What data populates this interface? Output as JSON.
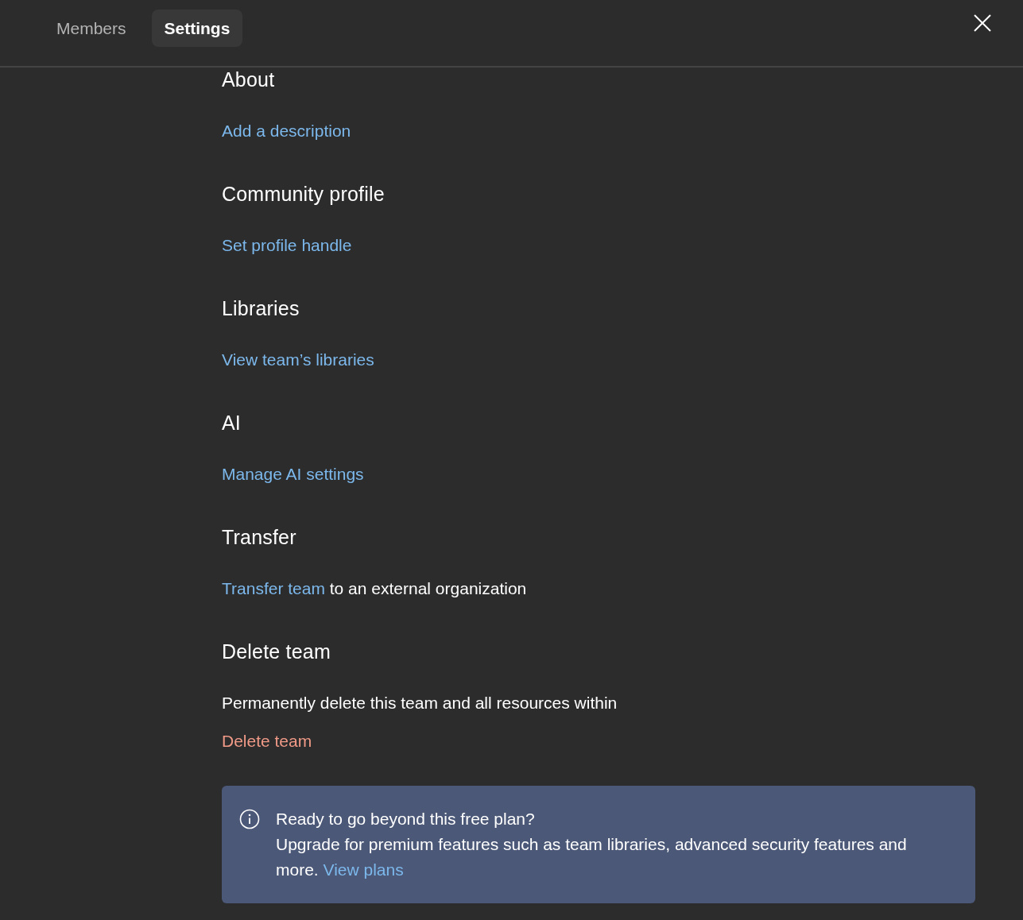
{
  "tabs": [
    {
      "label": "Members",
      "selected": false
    },
    {
      "label": "Settings",
      "selected": true
    }
  ],
  "sections": [
    {
      "title": "About",
      "items": [
        {
          "kind": "link",
          "text": "Add a description"
        }
      ]
    },
    {
      "title": "Community profile",
      "items": [
        {
          "kind": "link",
          "text": "Set profile handle"
        }
      ]
    },
    {
      "title": "Libraries",
      "items": [
        {
          "kind": "link",
          "text": "View team’s libraries"
        }
      ]
    },
    {
      "title": "AI",
      "items": [
        {
          "kind": "link",
          "text": "Manage AI settings"
        }
      ]
    },
    {
      "title": "Transfer",
      "items": [
        {
          "kind": "link_sentence",
          "link": "Transfer team",
          "text": "to an external organization"
        }
      ]
    },
    {
      "title": "Delete team",
      "items": [
        {
          "kind": "text",
          "text": "Permanently delete this team and all resources within"
        },
        {
          "kind": "danger_link",
          "text": "Delete team"
        }
      ]
    }
  ],
  "banner": {
    "title": "Ready to go beyond this free plan?",
    "text": "Upgrade for premium features such as team libraries, advanced security features and more.",
    "link": "View plans"
  }
}
